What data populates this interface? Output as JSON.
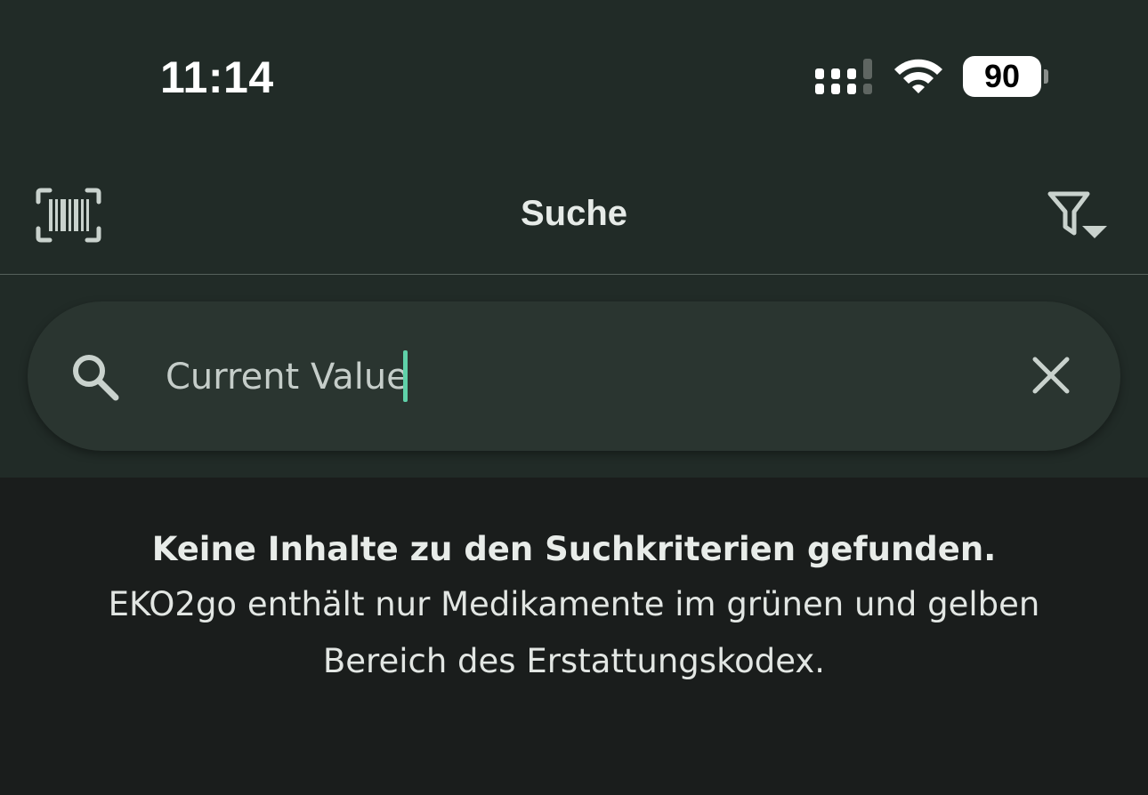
{
  "status_bar": {
    "time": "11:14",
    "battery_level": "90",
    "icons": [
      "signal-icon",
      "wifi-icon",
      "battery-icon"
    ]
  },
  "nav": {
    "title": "Suche",
    "left_icon": "barcode-scanner-icon",
    "right_icon": "filter-dropdown-icon"
  },
  "search": {
    "value": "Current Value",
    "icon": "search-icon",
    "clear_icon": "close-icon"
  },
  "empty_state": {
    "title": "Keine Inhalte zu den Suchkriterien gefunden.",
    "body_line1": "EKO2go enthält nur Medikamente im grünen und gelben",
    "body_line2": "Bereich des Erstattungskodex."
  },
  "colors": {
    "header_bg": "#212b27",
    "page_bg": "#1a1d1c",
    "search_bg": "#2a3530",
    "accent_caret": "#5fd1a8"
  }
}
